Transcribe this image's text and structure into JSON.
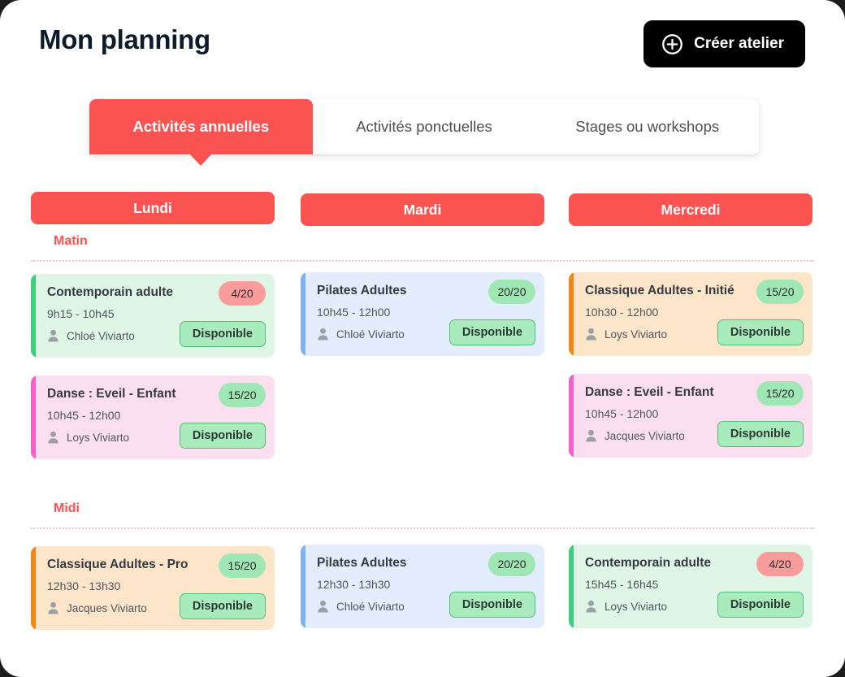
{
  "header": {
    "title": "Mon planning",
    "create_button": {
      "label": "Créer atelier",
      "icon": "plus-circle-icon"
    }
  },
  "tabs": [
    {
      "label": "Activités annuelles",
      "active": true
    },
    {
      "label": "Activités ponctuelles",
      "active": false
    },
    {
      "label": "Stages ou workshops",
      "active": false
    }
  ],
  "days": [
    "Lundi",
    "Mardi",
    "Mercredi"
  ],
  "sections": [
    {
      "label": "Matin"
    },
    {
      "label": "Midi"
    }
  ],
  "colors": {
    "accent_red": "#fb5252",
    "day_header": "#fb5252",
    "badge_green": "#9fe7b4",
    "badge_red": "#fb9c9c",
    "button_green_fill": "#a9ebbd",
    "button_green_border": "#4cc276",
    "card_green": "#dff5e6",
    "card_green_accent": "#3ecf7c",
    "card_pink": "#fbdff0",
    "card_pink_accent": "#f760c8",
    "card_blue": "#e4edfd",
    "card_blue_accent": "#7fb1f5",
    "card_orange": "#fde5c9",
    "card_orange_accent": "#f3861a",
    "divider": "#fbc4c4"
  },
  "grid": {
    "matin": [
      [
        {
          "title": "Contemporain adulte",
          "time": "9h15 - 10h45",
          "person": "Chloé Viviarto",
          "capacity": "4/20",
          "capacity_state": "red",
          "status": "Disponible",
          "theme": "green"
        },
        {
          "title": "Danse : Eveil - Enfant",
          "time": "10h45 - 12h00",
          "person": "Loys Viviarto",
          "capacity": "15/20",
          "capacity_state": "green",
          "status": "Disponible",
          "theme": "pink"
        }
      ],
      [
        {
          "title": "Pilates Adultes",
          "time": "10h45 - 12h00",
          "person": "Chloé Viviarto",
          "capacity": "20/20",
          "capacity_state": "green",
          "status": "Disponible",
          "theme": "blue"
        }
      ],
      [
        {
          "title": "Classique Adultes - Initié",
          "time": "10h30 - 12h00",
          "person": "Loys Viviarto",
          "capacity": "15/20",
          "capacity_state": "green",
          "status": "Disponible",
          "theme": "orange"
        },
        {
          "title": "Danse : Eveil - Enfant",
          "time": "10h45 - 12h00",
          "person": "Jacques Viviarto",
          "capacity": "15/20",
          "capacity_state": "green",
          "status": "Disponible",
          "theme": "pink"
        }
      ]
    ],
    "midi": [
      [
        {
          "title": "Classique Adultes - Pro",
          "time": "12h30 - 13h30",
          "person": "Jacques Viviarto",
          "capacity": "15/20",
          "capacity_state": "green",
          "status": "Disponible",
          "theme": "orange"
        }
      ],
      [
        {
          "title": "Pilates Adultes",
          "time": "12h30 - 13h30",
          "person": "Chloé Viviarto",
          "capacity": "20/20",
          "capacity_state": "green",
          "status": "Disponible",
          "theme": "blue"
        }
      ],
      [
        {
          "title": "Contemporain adulte",
          "time": "15h45 - 16h45",
          "person": "Loys Viviarto",
          "capacity": "4/20",
          "capacity_state": "red",
          "status": "Disponible",
          "theme": "green"
        }
      ]
    ]
  }
}
